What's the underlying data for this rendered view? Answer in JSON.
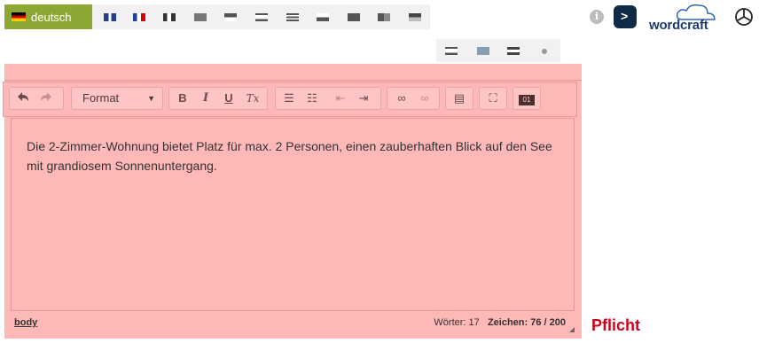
{
  "language_bar": {
    "active_label": "deutsch",
    "flags_row1": [
      "uk-flag",
      "fr-flag",
      "it-flag",
      "flag-4",
      "flag-5",
      "flag-6",
      "flag-7",
      "flag-8",
      "flag-9",
      "flag-10",
      "flag-11"
    ],
    "flags_row2": [
      "flag-12",
      "flag-13",
      "flag-14",
      "flag-15"
    ]
  },
  "brand": {
    "wordcraft": "wordcraft"
  },
  "toolbar": {
    "format_label": "Format",
    "bold": "B",
    "italic": "I",
    "underline": "U",
    "clear_format": "Tx"
  },
  "editor": {
    "content": "Die 2-Zimmer-Wohnung bietet Platz für max. 2 Personen, einen zauberhaften Blick auf den See mit grandiosem Sonnenuntergang."
  },
  "statusbar": {
    "path": "body",
    "words": "Wörter: 17",
    "chars": "Zeichen: 76 / 200"
  },
  "field_status": "Pflicht"
}
